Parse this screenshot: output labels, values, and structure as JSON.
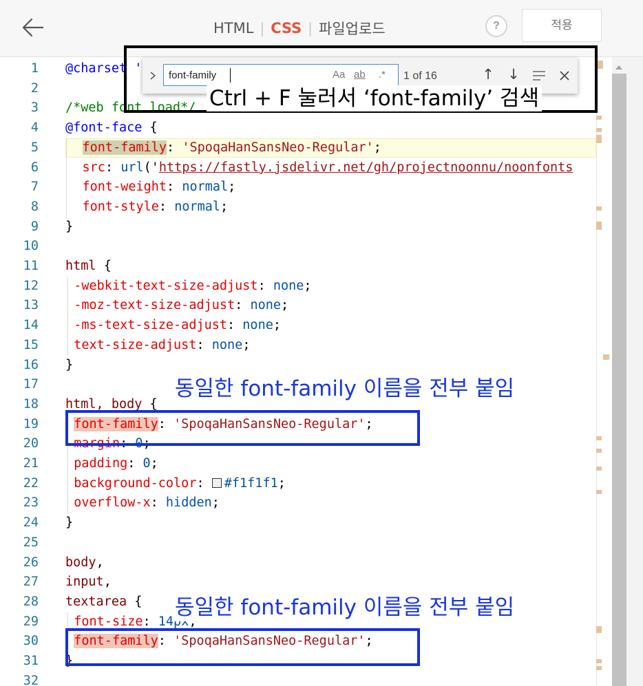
{
  "topbar": {
    "tabs": [
      {
        "label": "HTML",
        "active": false
      },
      {
        "label": "CSS",
        "active": true
      },
      {
        "label": "파일업로드",
        "active": false
      }
    ],
    "help_label": "?",
    "apply_label": "적용",
    "accent_color": "#e2553d"
  },
  "find": {
    "query": "font-family",
    "match_case_label": "Aa",
    "whole_word_label": "ab",
    "regex_label": ".*",
    "count": "1 of 16",
    "prev_icon": "arrow-up-icon",
    "next_icon": "arrow-down-icon",
    "selection_icon": "find-in-selection-icon",
    "close_icon": "close-icon"
  },
  "code": [
    {
      "n": "1",
      "tokens": [
        {
          "t": "@charset '",
          "c": "kw"
        }
      ]
    },
    {
      "n": "2",
      "tokens": []
    },
    {
      "n": "3",
      "tokens": [
        {
          "t": "/*web font load*/",
          "c": "com"
        }
      ]
    },
    {
      "n": "4",
      "tokens": [
        {
          "t": "@font-face",
          "c": "kw"
        },
        {
          "t": " {",
          "c": "pun"
        }
      ]
    },
    {
      "n": "5",
      "indent": 2,
      "current": true,
      "tokens": [
        {
          "t": "font-family",
          "c": "prop",
          "hl": "cur"
        },
        {
          "t": ": ",
          "c": "pun"
        },
        {
          "t": "'SpoqaHanSansNeo-Regular'",
          "c": "str"
        },
        {
          "t": ";",
          "c": "pun"
        }
      ]
    },
    {
      "n": "6",
      "indent": 2,
      "tokens": [
        {
          "t": "src",
          "c": "prop"
        },
        {
          "t": ": ",
          "c": "pun"
        },
        {
          "t": "url",
          "c": "val"
        },
        {
          "t": "('",
          "c": "pun"
        },
        {
          "t": "https://fastly.jsdelivr.net/gh/projectnoonnu/noonfonts",
          "c": "url"
        }
      ]
    },
    {
      "n": "7",
      "indent": 2,
      "tokens": [
        {
          "t": "font-weight",
          "c": "prop"
        },
        {
          "t": ": ",
          "c": "pun"
        },
        {
          "t": "normal",
          "c": "val"
        },
        {
          "t": ";",
          "c": "pun"
        }
      ]
    },
    {
      "n": "8",
      "indent": 2,
      "tokens": [
        {
          "t": "font-style",
          "c": "prop"
        },
        {
          "t": ": ",
          "c": "pun"
        },
        {
          "t": "normal",
          "c": "val"
        },
        {
          "t": ";",
          "c": "pun"
        }
      ]
    },
    {
      "n": "9",
      "tokens": [
        {
          "t": "}",
          "c": "pun"
        }
      ]
    },
    {
      "n": "10",
      "tokens": []
    },
    {
      "n": "11",
      "tokens": [
        {
          "t": "html",
          "c": "sel"
        },
        {
          "t": " {",
          "c": "pun"
        }
      ]
    },
    {
      "n": "12",
      "indent": 1,
      "tokens": [
        {
          "t": "-webkit-text-size-adjust",
          "c": "prop"
        },
        {
          "t": ": ",
          "c": "pun"
        },
        {
          "t": "none",
          "c": "val"
        },
        {
          "t": ";",
          "c": "pun"
        }
      ]
    },
    {
      "n": "13",
      "indent": 1,
      "tokens": [
        {
          "t": "-moz-text-size-adjust",
          "c": "prop"
        },
        {
          "t": ": ",
          "c": "pun"
        },
        {
          "t": "none",
          "c": "val"
        },
        {
          "t": ";",
          "c": "pun"
        }
      ]
    },
    {
      "n": "14",
      "indent": 1,
      "tokens": [
        {
          "t": "-ms-text-size-adjust",
          "c": "prop"
        },
        {
          "t": ": ",
          "c": "pun"
        },
        {
          "t": "none",
          "c": "val"
        },
        {
          "t": ";",
          "c": "pun"
        }
      ]
    },
    {
      "n": "15",
      "indent": 1,
      "tokens": [
        {
          "t": "text-size-adjust",
          "c": "prop"
        },
        {
          "t": ": ",
          "c": "pun"
        },
        {
          "t": "none",
          "c": "val"
        },
        {
          "t": ";",
          "c": "pun"
        }
      ]
    },
    {
      "n": "16",
      "tokens": [
        {
          "t": "}",
          "c": "pun"
        }
      ]
    },
    {
      "n": "17",
      "tokens": []
    },
    {
      "n": "18",
      "tokens": [
        {
          "t": "html, body",
          "c": "sel"
        },
        {
          "t": " {",
          "c": "pun"
        }
      ]
    },
    {
      "n": "19",
      "indent": 1,
      "tokens": [
        {
          "t": "font-family",
          "c": "prop",
          "hl": "match"
        },
        {
          "t": ": ",
          "c": "pun"
        },
        {
          "t": "'SpoqaHanSansNeo-Regular'",
          "c": "str"
        },
        {
          "t": ";",
          "c": "pun"
        }
      ]
    },
    {
      "n": "20",
      "indent": 1,
      "tokens": [
        {
          "t": "margin",
          "c": "prop"
        },
        {
          "t": ": ",
          "c": "pun"
        },
        {
          "t": "0",
          "c": "val"
        },
        {
          "t": ";",
          "c": "pun"
        }
      ]
    },
    {
      "n": "21",
      "indent": 1,
      "tokens": [
        {
          "t": "padding",
          "c": "prop"
        },
        {
          "t": ": ",
          "c": "pun"
        },
        {
          "t": "0",
          "c": "val"
        },
        {
          "t": ";",
          "c": "pun"
        }
      ]
    },
    {
      "n": "22",
      "indent": 1,
      "tokens": [
        {
          "t": "background-color",
          "c": "prop"
        },
        {
          "t": ": ",
          "c": "pun"
        },
        {
          "t": "#f1f1f1",
          "c": "val",
          "swatch": true
        },
        {
          "t": ";",
          "c": "pun"
        }
      ]
    },
    {
      "n": "23",
      "indent": 1,
      "tokens": [
        {
          "t": "overflow-x",
          "c": "prop"
        },
        {
          "t": ": ",
          "c": "pun"
        },
        {
          "t": "hidden",
          "c": "val"
        },
        {
          "t": ";",
          "c": "pun"
        }
      ]
    },
    {
      "n": "24",
      "tokens": [
        {
          "t": "}",
          "c": "pun"
        }
      ]
    },
    {
      "n": "25",
      "tokens": []
    },
    {
      "n": "26",
      "tokens": [
        {
          "t": "body",
          "c": "sel"
        },
        {
          "t": ",",
          "c": "pun"
        }
      ]
    },
    {
      "n": "27",
      "tokens": [
        {
          "t": "input",
          "c": "sel"
        },
        {
          "t": ",",
          "c": "pun"
        }
      ]
    },
    {
      "n": "28",
      "tokens": [
        {
          "t": "textarea",
          "c": "sel"
        },
        {
          "t": " {",
          "c": "pun"
        }
      ]
    },
    {
      "n": "29",
      "indent": 1,
      "tokens": [
        {
          "t": "font-size",
          "c": "prop"
        },
        {
          "t": ": ",
          "c": "pun"
        },
        {
          "t": "14px",
          "c": "val"
        },
        {
          "t": ";",
          "c": "pun"
        }
      ]
    },
    {
      "n": "30",
      "indent": 1,
      "tokens": [
        {
          "t": "font-family",
          "c": "prop",
          "hl": "match"
        },
        {
          "t": ": ",
          "c": "pun"
        },
        {
          "t": "'SpoqaHanSansNeo-Regular'",
          "c": "str"
        },
        {
          "t": ";",
          "c": "pun"
        }
      ]
    },
    {
      "n": "31",
      "tokens": [
        {
          "t": "}",
          "c": "pun"
        }
      ]
    },
    {
      "n": "32",
      "tokens": []
    }
  ],
  "annotations": {
    "search_note": "Ctrl + F 눌러서 ‘font-family’ 검색",
    "same_name_note_1": "동일한 font-family 이름을 전부 붙임",
    "same_name_note_2": "동일한 font-family 이름을 전부 붙임"
  }
}
